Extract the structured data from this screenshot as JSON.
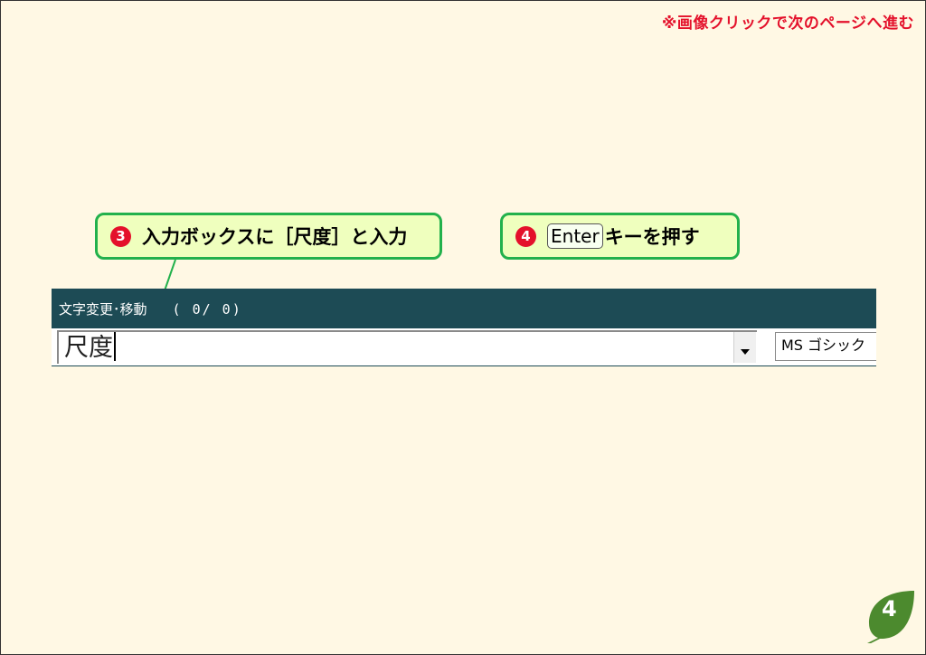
{
  "header": {
    "note": "※画像クリックで次のページへ進む"
  },
  "callouts": {
    "step3": {
      "number": "3",
      "text": "入力ボックスに［尺度］と入力"
    },
    "step4": {
      "number": "4",
      "key": "Enter",
      "text": "キーを押す"
    }
  },
  "toolbar": {
    "title": "文字変更･移動",
    "counter": "( 0/  0)",
    "search_value": "尺度",
    "font_name": "MS ゴシック"
  },
  "page": {
    "number": "4"
  },
  "colors": {
    "background": "#fff8e4",
    "accent_red": "#e4112b",
    "callout_fill": "#efffbe",
    "callout_border": "#22b14c",
    "toolbar_bg": "#1d4b55",
    "badge_green": "#4c8a2e"
  }
}
